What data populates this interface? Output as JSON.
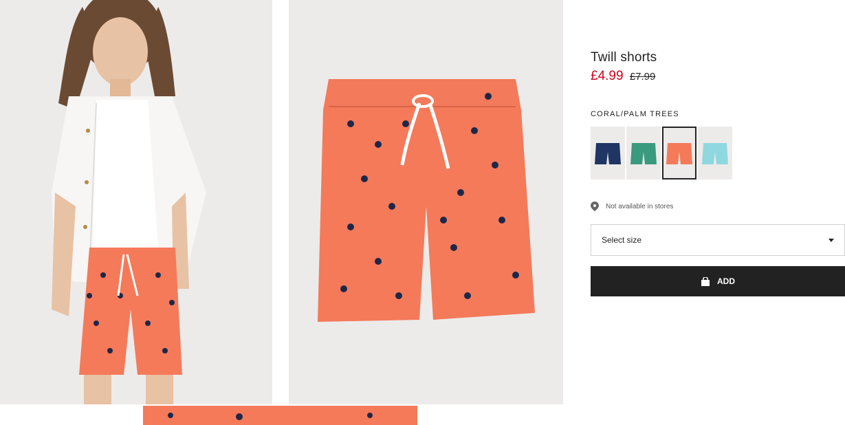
{
  "product": {
    "title": "Twill shorts",
    "price_sale": "£4.99",
    "price_original": "£7.99",
    "color_name": "CORAL/PALM TREES"
  },
  "swatches": [
    {
      "name": "dark-blue",
      "color": "#1f3563"
    },
    {
      "name": "green",
      "color": "#3a9a7d"
    },
    {
      "name": "coral",
      "color": "#f47a5a",
      "selected": true
    },
    {
      "name": "light-blue",
      "color": "#8fd8df"
    }
  ],
  "availability": {
    "text": "Not available in stores",
    "icon": "location-pin-icon"
  },
  "size_select": {
    "label": "Select size",
    "icon": "caret-down-icon"
  },
  "add_button": {
    "label": "ADD",
    "icon": "shopping-bag-icon"
  },
  "colors": {
    "sale": "#d0021b",
    "button_bg": "#222222",
    "coral": "#f47a5a",
    "print": "#1e2748"
  }
}
